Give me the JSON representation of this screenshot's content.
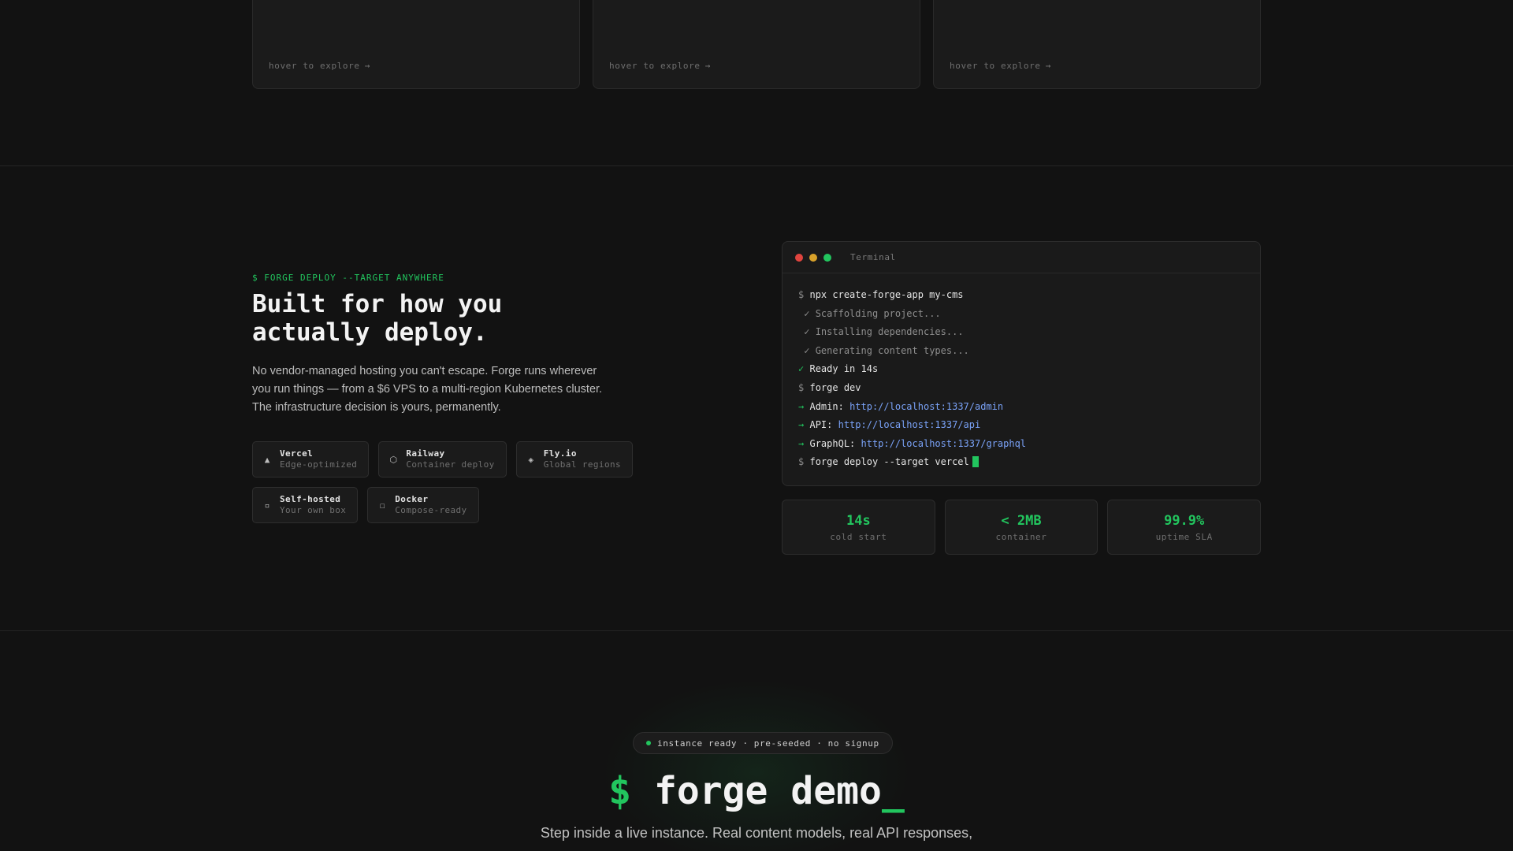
{
  "top_cards": [
    {
      "hint": "hover to explore",
      "arrow": "→"
    },
    {
      "hint": "hover to explore",
      "arrow": "→"
    },
    {
      "hint": "hover to explore",
      "arrow": "→"
    }
  ],
  "deploy": {
    "eyebrow": "$ FORGE DEPLOY --TARGET ANYWHERE",
    "headline_line1": "Built for how you",
    "headline_line2": "actually deploy.",
    "body": "No vendor-managed hosting you can't escape. Forge runs wherever you run things — from a $6 VPS to a multi-region Kubernetes cluster. The infrastructure decision is yours, permanently.",
    "targets": [
      {
        "icon": "▲",
        "name": "Vercel",
        "sub": "Edge-optimized"
      },
      {
        "icon": "⬡",
        "name": "Railway",
        "sub": "Container deploy"
      },
      {
        "icon": "◈",
        "name": "Fly.io",
        "sub": "Global regions"
      },
      {
        "icon": "▫",
        "name": "Self-hosted",
        "sub": "Your own box"
      },
      {
        "icon": "☐",
        "name": "Docker",
        "sub": "Compose-ready"
      }
    ]
  },
  "terminal": {
    "title": "Terminal",
    "dot_colors": [
      "#e0443e",
      "#d8a12a",
      "#22c55e"
    ],
    "prompt": "$",
    "check": "✓",
    "arrow": "→",
    "cmd1": "npx create-forge-app my-cms",
    "step1": "Scaffolding project...",
    "step2": "Installing dependencies...",
    "step3": "Generating content types...",
    "ready": "Ready in 14s",
    "cmd2": "forge dev",
    "admin_label": "Admin:",
    "admin_url": "http://localhost:1337/admin",
    "api_label": "API:",
    "api_url": "http://localhost:1337/api",
    "graphql_label": "GraphQL:",
    "graphql_url": "http://localhost:1337/graphql",
    "cmd3": "forge deploy --target vercel"
  },
  "stats": [
    {
      "value": "14s",
      "label": "cold start"
    },
    {
      "value": "< 2MB",
      "label": "container"
    },
    {
      "value": "99.9%",
      "label": "uptime SLA"
    }
  ],
  "demo": {
    "badge": "instance ready · pre-seeded · no signup",
    "title_dollar": "$",
    "title_text": " forge demo",
    "title_cursor": "_",
    "subtitle": "Step inside a live instance. Real content models, real API responses,"
  },
  "colors": {
    "accent": "#22c55e",
    "link": "#7aa2f7",
    "background": "#121212"
  }
}
